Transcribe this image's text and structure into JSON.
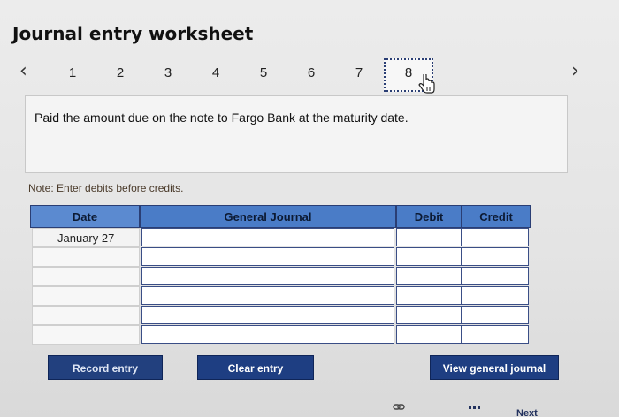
{
  "page": {
    "title": "Journal entry worksheet"
  },
  "pager": {
    "prev_icon": "chevron-left-icon",
    "next_icon": "chevron-right-icon",
    "pages": [
      "1",
      "2",
      "3",
      "4",
      "5",
      "6",
      "7",
      "8"
    ],
    "active_page": "8"
  },
  "prompt": {
    "text": "Paid the amount due on the note to Fargo Bank at the maturity date."
  },
  "note": {
    "text": "Note: Enter debits before credits."
  },
  "table": {
    "headers": {
      "date": "Date",
      "journal": "General Journal",
      "debit": "Debit",
      "credit": "Credit"
    },
    "rows": [
      {
        "date": "January 27",
        "account": "",
        "debit": "",
        "credit": ""
      },
      {
        "date": "",
        "account": "",
        "debit": "",
        "credit": ""
      },
      {
        "date": "",
        "account": "",
        "debit": "",
        "credit": ""
      },
      {
        "date": "",
        "account": "",
        "debit": "",
        "credit": ""
      },
      {
        "date": "",
        "account": "",
        "debit": "",
        "credit": ""
      },
      {
        "date": "",
        "account": "",
        "debit": "",
        "credit": ""
      }
    ]
  },
  "buttons": {
    "record": "Record entry",
    "clear": "Clear entry",
    "view": "View general journal"
  },
  "footer": {
    "next_label": "Next"
  },
  "colors": {
    "header_blue": "#4a7cc7",
    "button_navy": "#1e3e82",
    "input_border": "#3a4e86"
  }
}
